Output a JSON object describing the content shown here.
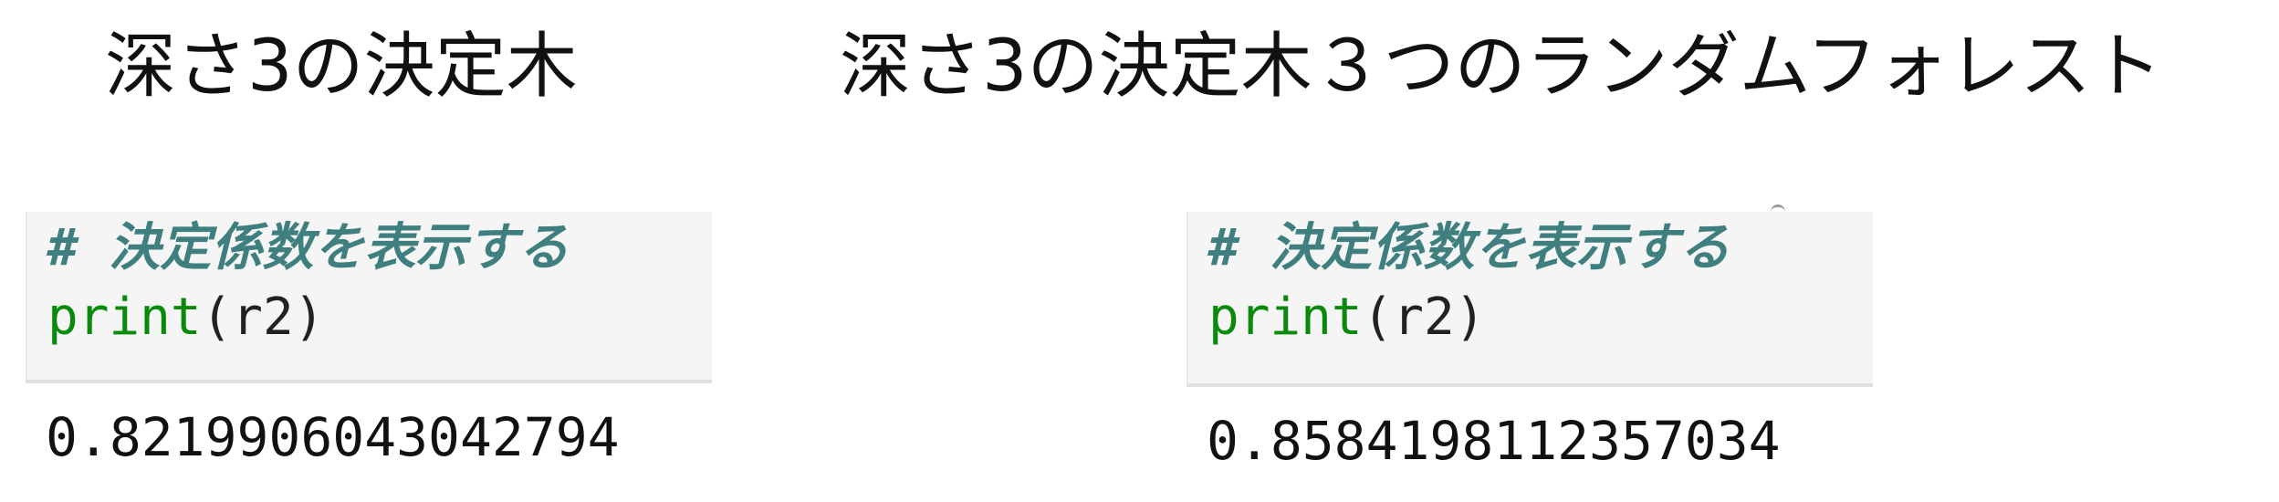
{
  "left": {
    "title": "深さ3の決定木",
    "comment": "# 決定係数を表示する",
    "print_func": "print",
    "print_args": "(r2)",
    "output": "0.8219906043042794"
  },
  "right": {
    "title": "深さ3の決定木３つのランダムフォレスト",
    "comment": "# 決定係数を表示する",
    "print_func": "print",
    "print_args": "(r2)",
    "output": "0.8584198112357034"
  }
}
